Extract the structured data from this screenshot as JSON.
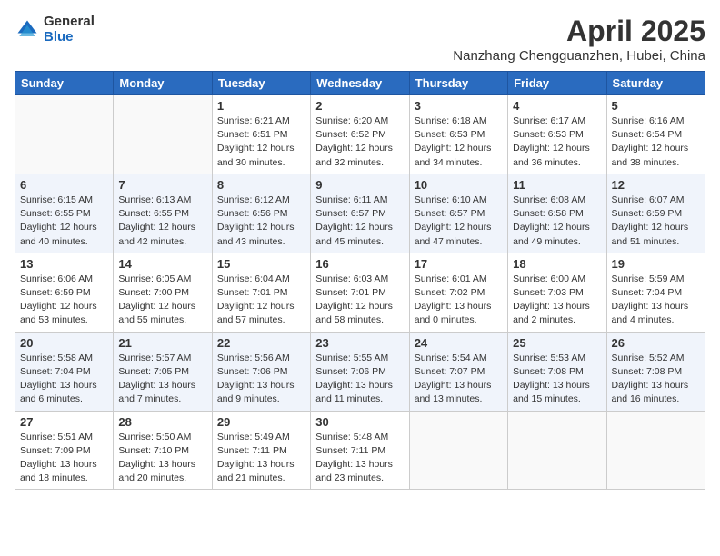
{
  "header": {
    "logo_general": "General",
    "logo_blue": "Blue",
    "month_year": "April 2025",
    "location": "Nanzhang Chengguanzhen, Hubei, China"
  },
  "weekdays": [
    "Sunday",
    "Monday",
    "Tuesday",
    "Wednesday",
    "Thursday",
    "Friday",
    "Saturday"
  ],
  "weeks": [
    [
      {
        "day": "",
        "info": ""
      },
      {
        "day": "",
        "info": ""
      },
      {
        "day": "1",
        "info": "Sunrise: 6:21 AM\nSunset: 6:51 PM\nDaylight: 12 hours\nand 30 minutes."
      },
      {
        "day": "2",
        "info": "Sunrise: 6:20 AM\nSunset: 6:52 PM\nDaylight: 12 hours\nand 32 minutes."
      },
      {
        "day": "3",
        "info": "Sunrise: 6:18 AM\nSunset: 6:53 PM\nDaylight: 12 hours\nand 34 minutes."
      },
      {
        "day": "4",
        "info": "Sunrise: 6:17 AM\nSunset: 6:53 PM\nDaylight: 12 hours\nand 36 minutes."
      },
      {
        "day": "5",
        "info": "Sunrise: 6:16 AM\nSunset: 6:54 PM\nDaylight: 12 hours\nand 38 minutes."
      }
    ],
    [
      {
        "day": "6",
        "info": "Sunrise: 6:15 AM\nSunset: 6:55 PM\nDaylight: 12 hours\nand 40 minutes."
      },
      {
        "day": "7",
        "info": "Sunrise: 6:13 AM\nSunset: 6:55 PM\nDaylight: 12 hours\nand 42 minutes."
      },
      {
        "day": "8",
        "info": "Sunrise: 6:12 AM\nSunset: 6:56 PM\nDaylight: 12 hours\nand 43 minutes."
      },
      {
        "day": "9",
        "info": "Sunrise: 6:11 AM\nSunset: 6:57 PM\nDaylight: 12 hours\nand 45 minutes."
      },
      {
        "day": "10",
        "info": "Sunrise: 6:10 AM\nSunset: 6:57 PM\nDaylight: 12 hours\nand 47 minutes."
      },
      {
        "day": "11",
        "info": "Sunrise: 6:08 AM\nSunset: 6:58 PM\nDaylight: 12 hours\nand 49 minutes."
      },
      {
        "day": "12",
        "info": "Sunrise: 6:07 AM\nSunset: 6:59 PM\nDaylight: 12 hours\nand 51 minutes."
      }
    ],
    [
      {
        "day": "13",
        "info": "Sunrise: 6:06 AM\nSunset: 6:59 PM\nDaylight: 12 hours\nand 53 minutes."
      },
      {
        "day": "14",
        "info": "Sunrise: 6:05 AM\nSunset: 7:00 PM\nDaylight: 12 hours\nand 55 minutes."
      },
      {
        "day": "15",
        "info": "Sunrise: 6:04 AM\nSunset: 7:01 PM\nDaylight: 12 hours\nand 57 minutes."
      },
      {
        "day": "16",
        "info": "Sunrise: 6:03 AM\nSunset: 7:01 PM\nDaylight: 12 hours\nand 58 minutes."
      },
      {
        "day": "17",
        "info": "Sunrise: 6:01 AM\nSunset: 7:02 PM\nDaylight: 13 hours\nand 0 minutes."
      },
      {
        "day": "18",
        "info": "Sunrise: 6:00 AM\nSunset: 7:03 PM\nDaylight: 13 hours\nand 2 minutes."
      },
      {
        "day": "19",
        "info": "Sunrise: 5:59 AM\nSunset: 7:04 PM\nDaylight: 13 hours\nand 4 minutes."
      }
    ],
    [
      {
        "day": "20",
        "info": "Sunrise: 5:58 AM\nSunset: 7:04 PM\nDaylight: 13 hours\nand 6 minutes."
      },
      {
        "day": "21",
        "info": "Sunrise: 5:57 AM\nSunset: 7:05 PM\nDaylight: 13 hours\nand 7 minutes."
      },
      {
        "day": "22",
        "info": "Sunrise: 5:56 AM\nSunset: 7:06 PM\nDaylight: 13 hours\nand 9 minutes."
      },
      {
        "day": "23",
        "info": "Sunrise: 5:55 AM\nSunset: 7:06 PM\nDaylight: 13 hours\nand 11 minutes."
      },
      {
        "day": "24",
        "info": "Sunrise: 5:54 AM\nSunset: 7:07 PM\nDaylight: 13 hours\nand 13 minutes."
      },
      {
        "day": "25",
        "info": "Sunrise: 5:53 AM\nSunset: 7:08 PM\nDaylight: 13 hours\nand 15 minutes."
      },
      {
        "day": "26",
        "info": "Sunrise: 5:52 AM\nSunset: 7:08 PM\nDaylight: 13 hours\nand 16 minutes."
      }
    ],
    [
      {
        "day": "27",
        "info": "Sunrise: 5:51 AM\nSunset: 7:09 PM\nDaylight: 13 hours\nand 18 minutes."
      },
      {
        "day": "28",
        "info": "Sunrise: 5:50 AM\nSunset: 7:10 PM\nDaylight: 13 hours\nand 20 minutes."
      },
      {
        "day": "29",
        "info": "Sunrise: 5:49 AM\nSunset: 7:11 PM\nDaylight: 13 hours\nand 21 minutes."
      },
      {
        "day": "30",
        "info": "Sunrise: 5:48 AM\nSunset: 7:11 PM\nDaylight: 13 hours\nand 23 minutes."
      },
      {
        "day": "",
        "info": ""
      },
      {
        "day": "",
        "info": ""
      },
      {
        "day": "",
        "info": ""
      }
    ]
  ]
}
